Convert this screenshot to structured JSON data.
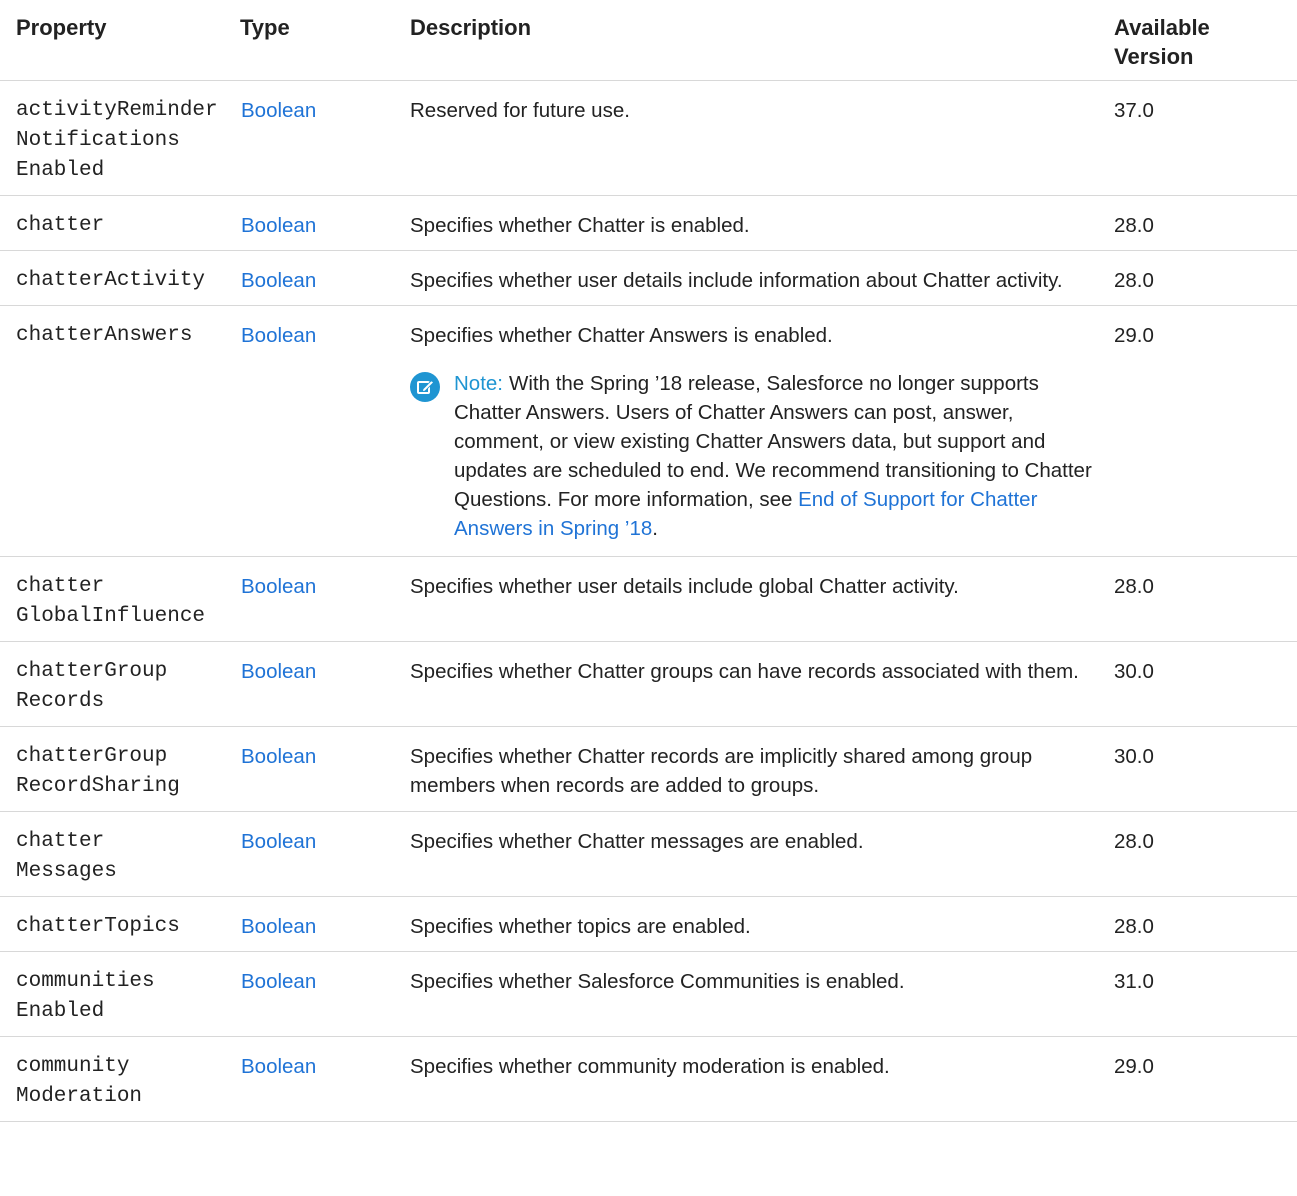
{
  "headers": {
    "property": "Property",
    "type": "Type",
    "description": "Description",
    "version": "Available Version"
  },
  "rows": [
    {
      "property_lines": [
        "activityReminder",
        "Notifications",
        "Enabled"
      ],
      "type": "Boolean",
      "description": "Reserved for future use.",
      "version": "37.0"
    },
    {
      "property_lines": [
        "chatter"
      ],
      "type": "Boolean",
      "description": "Specifies whether Chatter is enabled.",
      "version": "28.0"
    },
    {
      "property_lines": [
        "chatterActivity"
      ],
      "type": "Boolean",
      "description": "Specifies whether user details include information about Chatter activity.",
      "version": "28.0"
    },
    {
      "property_lines": [
        "chatterAnswers"
      ],
      "type": "Boolean",
      "description": "Specifies whether Chatter Answers is enabled.",
      "version": "29.0",
      "note": {
        "label": "Note:",
        "text": "With the Spring ’18 release, Salesforce no longer supports Chatter Answers. Users of Chatter Answers can post, answer, comment, or view existing Chatter Answers data, but support and updates are scheduled to end. We recommend transitioning to Chatter Questions. For more information, see ",
        "link_text": "End of Support for Chatter Answers in Spring ’18",
        "end_text": "."
      }
    },
    {
      "property_lines": [
        "chatter",
        "GlobalInfluence"
      ],
      "type": "Boolean",
      "description": "Specifies whether user details include global Chatter activity.",
      "version": "28.0"
    },
    {
      "property_lines": [
        "chatterGroup",
        "Records"
      ],
      "type": "Boolean",
      "description": "Specifies whether Chatter groups can have records associated with them.",
      "version": "30.0"
    },
    {
      "property_lines": [
        "chatterGroup",
        "RecordSharing"
      ],
      "type": "Boolean",
      "description": "Specifies whether Chatter records are implicitly shared among group members when records are added to groups.",
      "version": "30.0"
    },
    {
      "property_lines": [
        "chatter",
        "Messages"
      ],
      "type": "Boolean",
      "description": "Specifies whether Chatter messages are enabled.",
      "version": "28.0"
    },
    {
      "property_lines": [
        "chatterTopics"
      ],
      "type": "Boolean",
      "description": "Specifies whether topics are enabled.",
      "version": "28.0"
    },
    {
      "property_lines": [
        "communities",
        "Enabled"
      ],
      "type": "Boolean",
      "description": "Specifies whether Salesforce Communities is enabled.",
      "version": "31.0"
    },
    {
      "property_lines": [
        "community",
        "Moderation"
      ],
      "type": "Boolean",
      "description": "Specifies whether community moderation is enabled.",
      "version": "29.0"
    }
  ],
  "colors": {
    "link": "#1f73d6",
    "note_accent": "#1f95d2",
    "rule": "#d8d8d8"
  },
  "icons": {
    "note": "edit-note-icon"
  }
}
